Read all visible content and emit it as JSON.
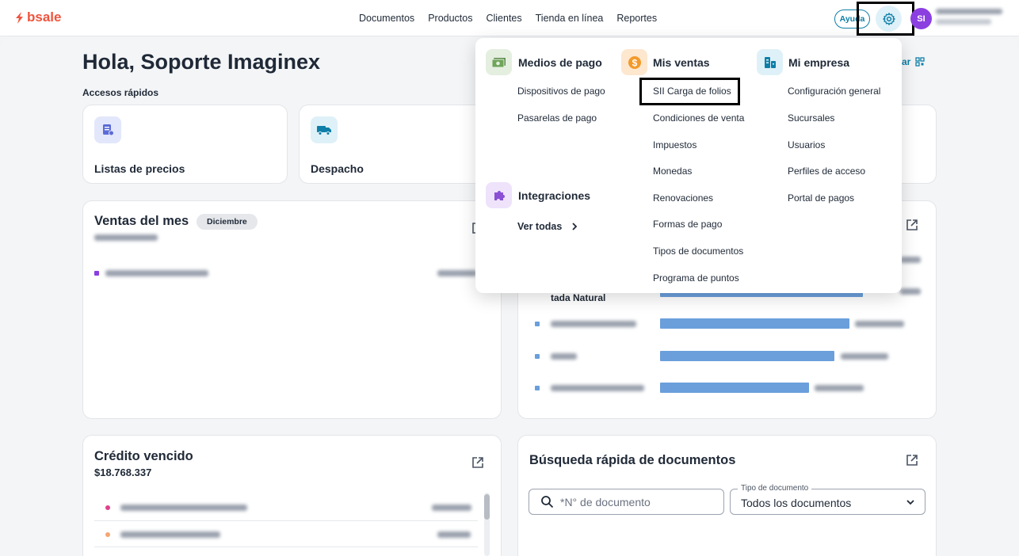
{
  "brand": {
    "name": "bsale",
    "color": "#f0533c"
  },
  "nav": [
    "Documentos",
    "Productos",
    "Clientes",
    "Tienda en línea",
    "Reportes"
  ],
  "header": {
    "help_label": "Ayuda",
    "avatar_initials": "SI",
    "accent": "#0e7fa8",
    "avatar_color": "#8b3fe0"
  },
  "page": {
    "greeting": "Hola, Soporte Imaginex",
    "quick_access_title": "Accesos rápidos",
    "edit_label": "ar"
  },
  "quick_access": [
    {
      "label": "Listas de precios",
      "icon": "price-list-icon"
    },
    {
      "label": "Despacho",
      "icon": "truck-icon"
    }
  ],
  "sales_card": {
    "title": "Ventas del mes",
    "month_badge": "Diciembre"
  },
  "top_products_card": {
    "visible_label": "tada Natural",
    "bars": [
      0.94,
      0.88,
      0.81,
      0.69
    ]
  },
  "credit_card": {
    "title": "Crédito vencido",
    "amount": "$18.768.337"
  },
  "search_card": {
    "title": "Búsqueda rápida de documentos",
    "search_placeholder": "*N° de documento",
    "doc_type_legend": "Tipo de documento",
    "doc_type_value": "Todos los documentos"
  },
  "settings_menu": {
    "medios_de_pago": {
      "title": "Medios de pago",
      "items": [
        "Dispositivos de pago",
        "Pasarelas de pago"
      ]
    },
    "integraciones": {
      "title": "Integraciones",
      "see_all": "Ver todas"
    },
    "mis_ventas": {
      "title": "Mis ventas",
      "items": [
        "SII Carga de folios",
        "Condiciones de venta",
        "Impuestos",
        "Monedas",
        "Renovaciones",
        "Formas de pago",
        "Tipos de documentos",
        "Programa de puntos"
      ]
    },
    "mi_empresa": {
      "title": "Mi empresa",
      "items": [
        "Configuración general",
        "Sucursales",
        "Usuarios",
        "Perfiles de acceso",
        "Portal de pagos"
      ]
    }
  }
}
